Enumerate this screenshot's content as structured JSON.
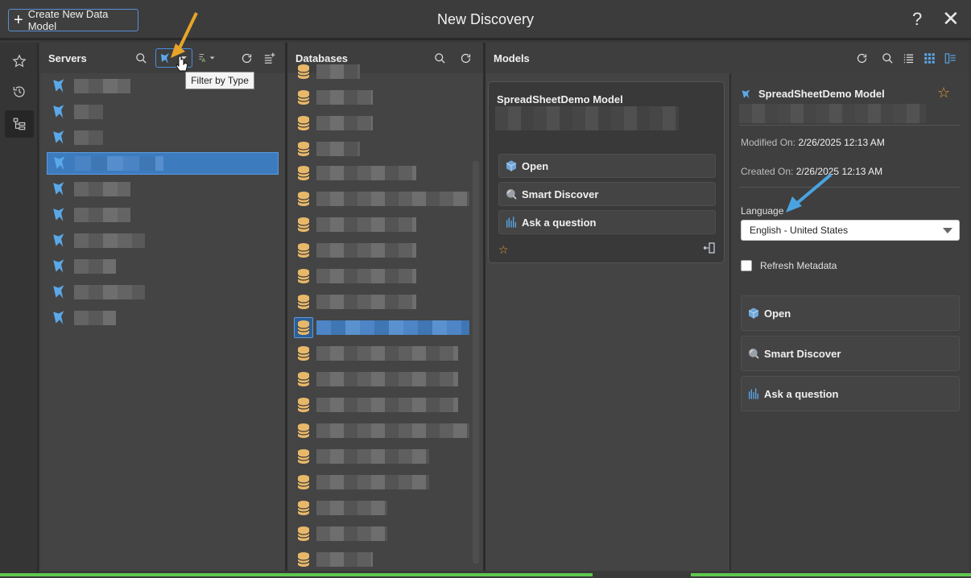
{
  "header": {
    "create_label": "Create New Data Model",
    "title": "New Discovery",
    "help_glyph": "?",
    "close_glyph": "✕"
  },
  "servers": {
    "title": "Servers",
    "tooltip": "Filter by Type",
    "rows": 10,
    "selected_index": 3
  },
  "databases": {
    "title": "Databases",
    "selected_index": 10
  },
  "models": {
    "title": "Models",
    "card": {
      "title": "SpreadSheetDemo Model",
      "actions": [
        "Open",
        "Smart Discover",
        "Ask a question"
      ]
    }
  },
  "details": {
    "title": "SpreadSheetDemo Model",
    "modified_label": "Modified On:",
    "modified_value": "2/26/2025 12:13 AM",
    "created_label": "Created On:",
    "created_value": "2/26/2025 12:13 AM",
    "language_label": "Language",
    "language_value": "English - United States",
    "refresh_label": "Refresh Metadata",
    "actions": [
      "Open",
      "Smart Discover",
      "Ask a question"
    ]
  },
  "colors": {
    "accent_blue": "#3d7bbf",
    "arrow_orange": "#e8a42a",
    "arrow_blue": "#4aa3e0",
    "star": "#e89a34",
    "db_icon": "#e8b86a"
  }
}
